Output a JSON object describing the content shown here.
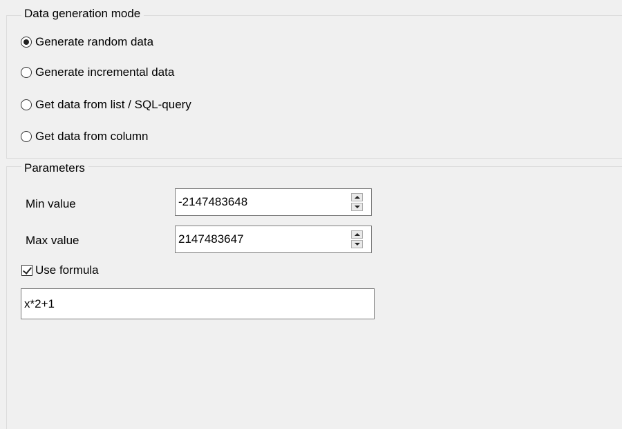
{
  "mode_group": {
    "title": "Data generation mode",
    "options": [
      {
        "label": "Generate random data",
        "checked": true
      },
      {
        "label": "Generate incremental data",
        "checked": false
      },
      {
        "label": "Get data from list / SQL-query",
        "checked": false
      },
      {
        "label": "Get data from column",
        "checked": false
      }
    ]
  },
  "params_group": {
    "title": "Parameters",
    "min_label": "Min value",
    "min_value": "-2147483648",
    "max_label": "Max value",
    "max_value": "2147483647",
    "use_formula_label": "Use formula",
    "use_formula_checked": true,
    "formula_value": "x*2+1"
  }
}
